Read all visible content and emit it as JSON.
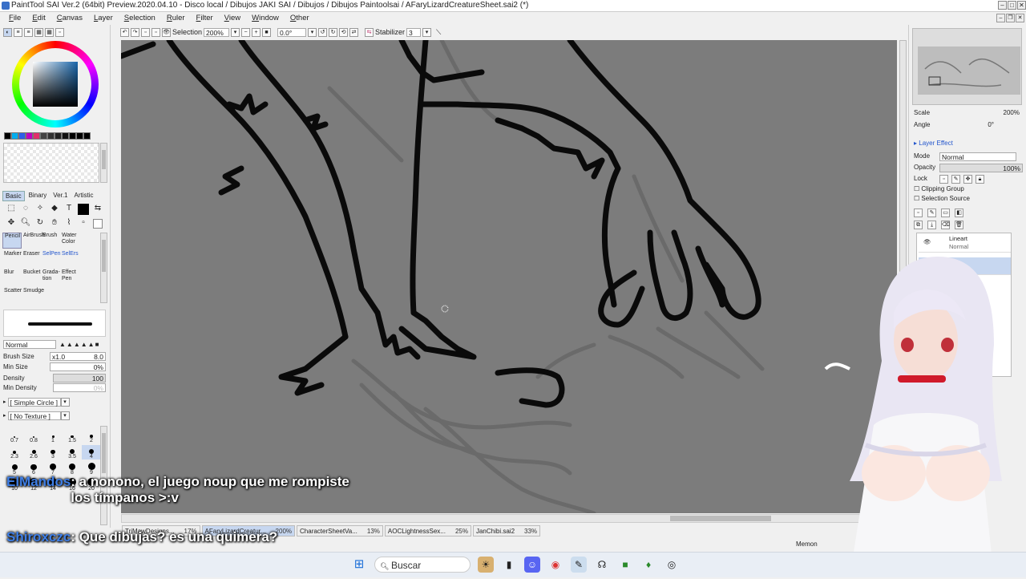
{
  "window": {
    "title": "PaintTool SAI Ver.2 (64bit) Preview.2020.04.10 - Disco local / Dibujos JAKI SAI / Dibujos / Dibujos Paintoolsai / AFaryLizardCreatureSheet.sai2 (*)"
  },
  "menu": [
    "File",
    "Edit",
    "Canvas",
    "Layer",
    "Selection",
    "Ruler",
    "Filter",
    "View",
    "Window",
    "Other"
  ],
  "toolbar": {
    "selection_label": "Selection",
    "zoom": "200%",
    "angle": "0.0°",
    "stabilizer_label": "Stabilizer",
    "stabilizer_value": "3"
  },
  "tool_tabs": [
    "Basic",
    "Binary",
    "Ver.1",
    "Artistic"
  ],
  "brushes": [
    {
      "label": "Pencil"
    },
    {
      "label": "AirBrush"
    },
    {
      "label": "Brush"
    },
    {
      "label": "Water Color"
    },
    {
      "label": ""
    },
    {
      "label": "Marker"
    },
    {
      "label": "Eraser"
    },
    {
      "label": "SelPen"
    },
    {
      "label": "SelErs"
    },
    {
      "label": ""
    },
    {
      "label": "Blur"
    },
    {
      "label": "Bucket"
    },
    {
      "label": "Grada-tion"
    },
    {
      "label": "Effect Pen"
    },
    {
      "label": ""
    },
    {
      "label": "Scatter"
    },
    {
      "label": "Smudge"
    },
    {
      "label": ""
    },
    {
      "label": ""
    },
    {
      "label": ""
    }
  ],
  "brush_props": {
    "blend_mode": "Normal",
    "size_label": "Brush Size",
    "size_mult": "x1.0",
    "size_value": "8.0",
    "min_size_label": "Min Size",
    "min_size_value": "0%",
    "density_label": "Density",
    "density_value": "100",
    "min_density_label": "Min Density",
    "min_density_value": "0%",
    "shape": "[ Simple Circle ]",
    "texture": "[ No Texture ]"
  },
  "brush_sizes": [
    "0.7",
    "0.8",
    "1",
    "1.5",
    "2",
    "2.3",
    "2.6",
    "3",
    "3.5",
    "4",
    "5",
    "6",
    "7",
    "8",
    "9",
    "10",
    "12",
    "14",
    "16",
    "20"
  ],
  "navigator": {
    "scale_label": "Scale",
    "scale_value": "200%",
    "angle_label": "Angle",
    "angle_value": "0°"
  },
  "layer_panel": {
    "section": "Layer Effect",
    "mode_label": "Mode",
    "mode_value": "Normal",
    "opacity_label": "Opacity",
    "opacity_value": "100%",
    "lock_label": "Lock",
    "clipping_label": "Clipping Group",
    "selection_source_label": "Selection Source",
    "layers": [
      {
        "name": "Lineart",
        "mode": "Normal"
      }
    ]
  },
  "documents": [
    {
      "name": "TriMawDesigns...",
      "zoom": "17%"
    },
    {
      "name": "AFaryLizardCreatur...",
      "zoom": "200%"
    },
    {
      "name": "CharacterSheetVa...",
      "zoom": "13%"
    },
    {
      "name": "AOCLightnessSex...",
      "zoom": "25%"
    },
    {
      "name": "JanChibi.sai2",
      "zoom": "33%"
    }
  ],
  "status": {
    "memory": "Memon"
  },
  "chat": [
    {
      "user": "ElMandos",
      "text": ": a nonono, el juego noup que me rompiste los tímpanos >:v"
    },
    {
      "user": "Shiroxczc",
      "text": ": Que dibujas? es una quimera?"
    }
  ],
  "taskbar": {
    "search_placeholder": "Buscar"
  },
  "colors": {
    "accent": "#c7d7f0",
    "canvas_bg": "#7c7c7c",
    "chat_user": "#3f7fe6"
  }
}
